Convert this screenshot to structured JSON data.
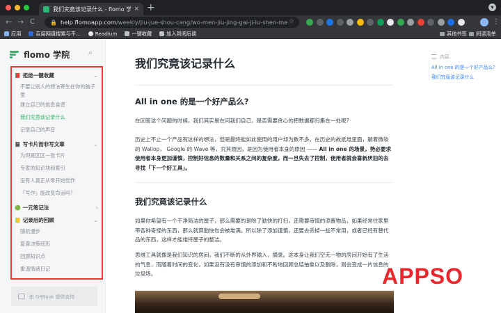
{
  "browser": {
    "tab_title": "我们究竟该记录什么 - flomo 学院",
    "tab_close": "×",
    "new_tab": "+",
    "url_host": "help.flomoapp.com",
    "url_path": "/weekly/jiu-jue-shou-cang/wo-men-jiu-jing-gai-ji-lu-shen-me",
    "nav_back": "←",
    "nav_forward": "→",
    "nav_reload": "C",
    "star": "☆",
    "bookmarks": [
      "应用",
      "百度网盘搜索与不...",
      "Readium",
      "一键收藏",
      "加入到阅后读"
    ],
    "bookmarks_right": [
      "其他书签",
      "阅读清单"
    ],
    "ext_colors": [
      "#34a853",
      "#5f6368",
      "#1a73e8",
      "#5f6368",
      "#9aa0a6",
      "#fbbc04",
      "#5f6368",
      "#0f9d58",
      "#e8eaed",
      "#34a853",
      "#9aa0a6",
      "#ea4335",
      "#5f6368",
      "#9aa0a6",
      "#1a73e8",
      "#e8eaed"
    ]
  },
  "sidebar": {
    "logo_text": "flomo 学院",
    "sections": [
      {
        "emoji": "📕",
        "title": "拒绝一键收藏",
        "chevron": "⌄",
        "items": [
          {
            "label": "不要让别人的想法寄生在你的脑子里"
          },
          {
            "label": "建立自己的信息食谱"
          },
          {
            "label": "我们究竟该记录什么",
            "active": true
          },
          {
            "label": "记录自己的声音"
          }
        ]
      },
      {
        "emoji": "📓",
        "title": "写卡片而非写文章",
        "chevron": "⌄",
        "items": [
          {
            "label": "为何是区区一张卡片"
          },
          {
            "label": "专家的知识块和索引"
          },
          {
            "label": "没有人真正从零开始创作"
          },
          {
            "label": "「写作」能改变命运吗？"
          }
        ]
      },
      {
        "emoji": "🟢",
        "title": "一元笔记法",
        "chevron": "›",
        "items": []
      },
      {
        "emoji": "📒",
        "title": "记录后的回顾",
        "chevron": "⌄",
        "items": [
          {
            "label": "随机漫步"
          },
          {
            "label": "复盘决策经历"
          },
          {
            "label": "回顾知识点"
          },
          {
            "label": "重温情绪日记"
          }
        ]
      }
    ],
    "gitbook_label": "由 GitBook 提供支持"
  },
  "article": {
    "title": "我们究竟该记录什么",
    "sections": [
      {
        "heading": "All in one 的是一个好产品么?",
        "paragraphs": [
          "在回答这个问题的时候，我们其实是在问我们自己，是否需要贪心的把数据都归集在一处呢?",
          "历史上不止一个产品有这样的想法，但是最终能如此使用的用户却为数不多。在历史的故纸堆里面，躺着微软的 Wallop， Google 的 Wave 等，究其原因，是因为使用者本身的原因 —— "
        ],
        "bold_tail": "All in one 的场景，势必要求使用者本身更加谨慎，控制好信息的数量和关系之间的复杂度，而一旦失去了控制，使用者就会喜新厌旧的去寻找「下一个好工具」。"
      },
      {
        "heading": "我们究竟该记录什么",
        "paragraphs": [
          "如果你希望有一个干净简洁的屋子，那么需要的是除了勤快的打扫，还需要审慎的添置物品，如果经常往家里带各种奇怪的东西，那么就算勤快也会被堆满。所以除了添加谨慎，还要去丢掉一些不常用，或者已经有替代品的东西，这样才能维持屋子的整洁。",
          "思维工具就像是我们知识的房间，我们不断的从外界输入，摘录。这本身让我们空无一物的房间开始有了生活的气息，而随着时间的变化，如果没有没有审慎的添加和不断地回顾总结抽象以及删除，则会变成一片信息的垃圾场。"
        ]
      }
    ]
  },
  "toc": {
    "header": "内容",
    "items": [
      "All in one 的是一个好产品么?",
      "我们究竟该记录什么"
    ]
  },
  "watermark": "APPSO",
  "colors": {
    "accent_green": "#31b66b",
    "toc_blue": "#3884ff",
    "highlight_red": "#e5392f",
    "watermark_red": "#e8262b"
  }
}
